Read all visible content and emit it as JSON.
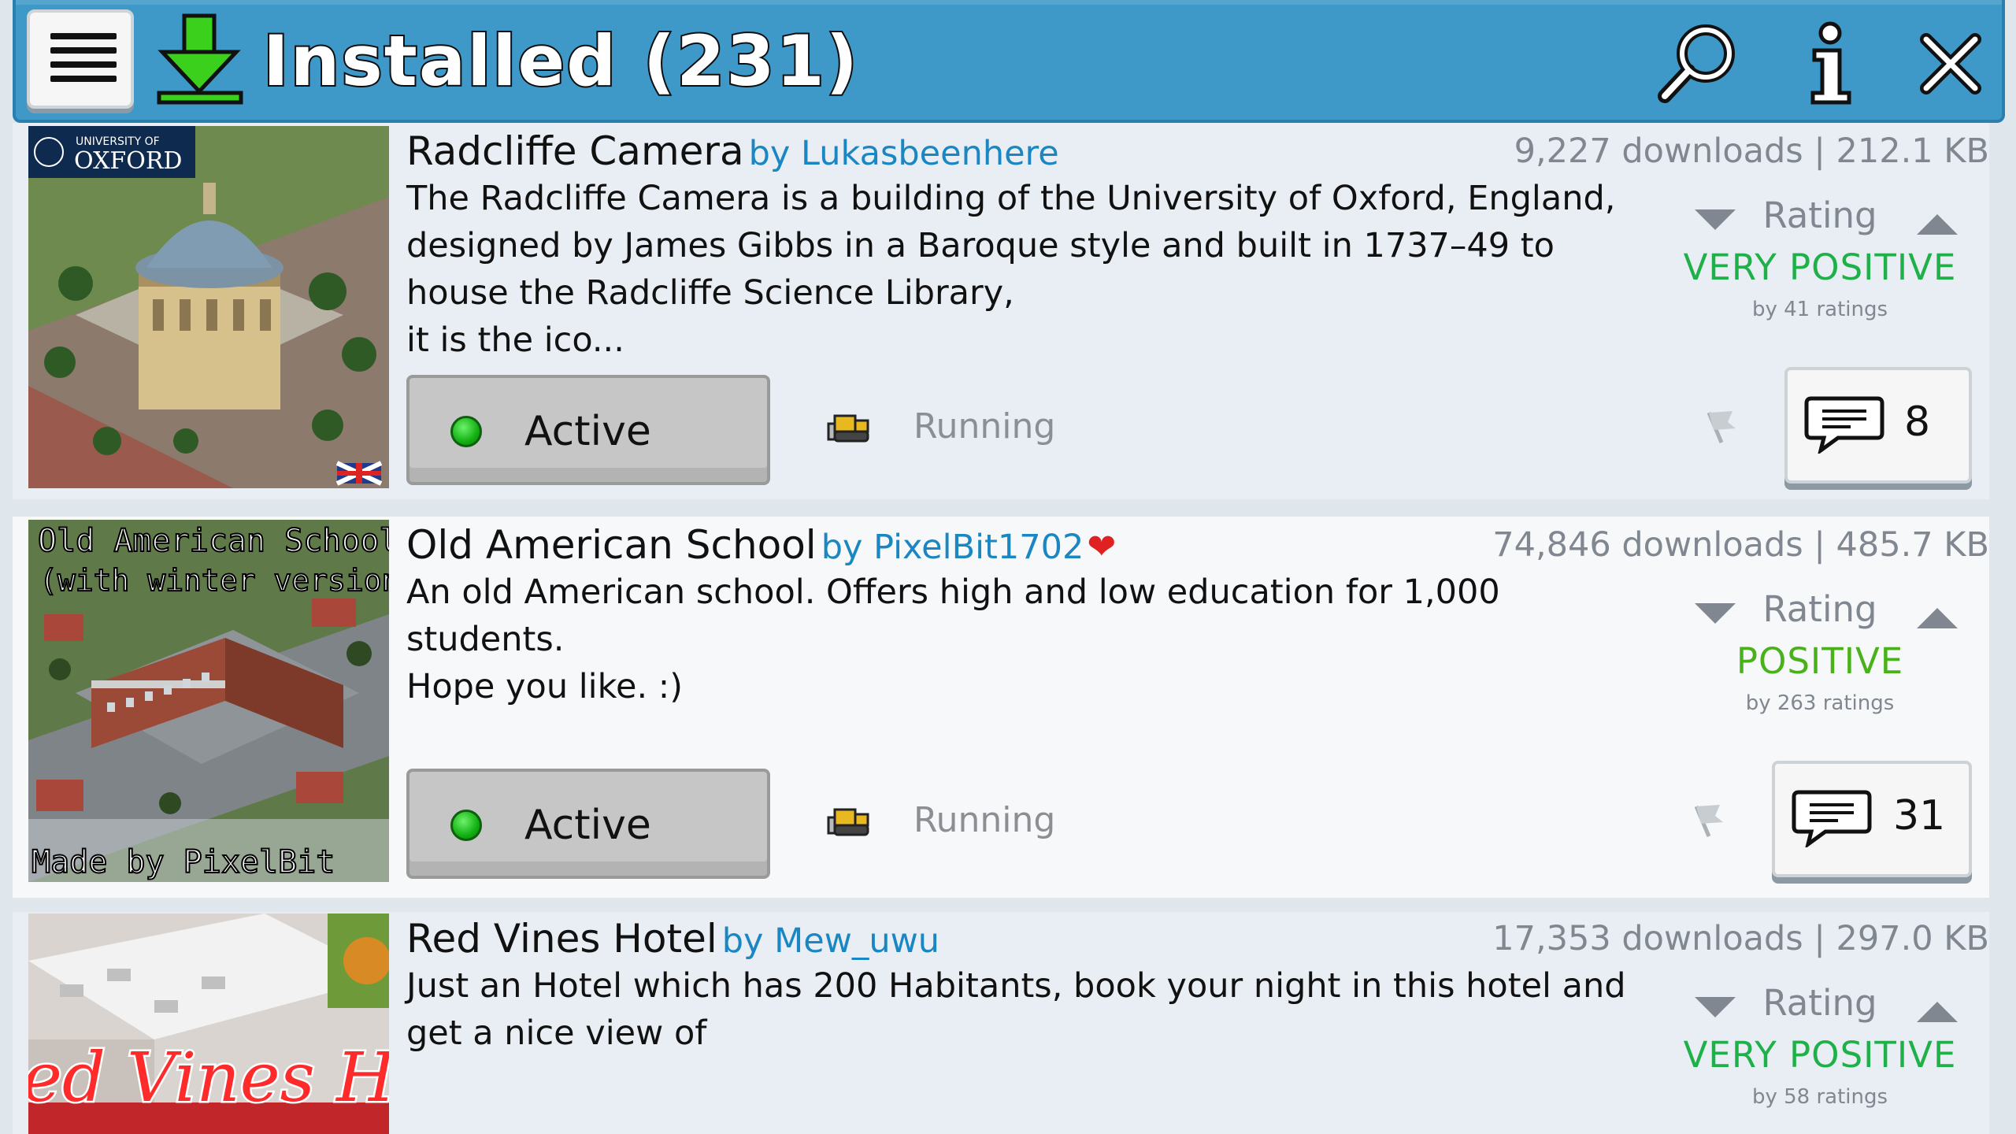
{
  "header": {
    "title": "Installed (231)",
    "icons": [
      "menu-icon",
      "download-icon",
      "search-icon",
      "info-icon",
      "close-icon"
    ]
  },
  "plugins": [
    {
      "name": "Radcliffe Camera",
      "author": "by Lukasbeenhere",
      "meta": "9,227 downloads | 212.1 KB",
      "description": "The Radcliffe Camera is a building of the University of Oxford, England, designed by James Gibbs in a Baroque style and built in 1737–49 to house the Radcliffe Science Library,\nit is the ico...",
      "thumb_text": [
        "UNIVERSITY OF",
        "OXFORD"
      ],
      "rating_label": "Rating",
      "rating_value": "VERY POSITIVE",
      "rating_count": "by 41 ratings",
      "status_button": "Active",
      "run_status": "Running",
      "comments": "8"
    },
    {
      "name": "Old American School",
      "author": "by PixelBit1702",
      "heart": "❤",
      "meta": "74,846 downloads | 485.7 KB",
      "description": "An old American school. Offers high and low education for 1,000 students.\nHope you like. :)",
      "thumb_text": [
        "Old American School",
        "(with winter version)",
        "Made by PixelBit"
      ],
      "rating_label": "Rating",
      "rating_value": "POSITIVE",
      "rating_count": "by 263 ratings",
      "status_button": "Active",
      "run_status": "Running",
      "comments": "31"
    },
    {
      "name": "Red Vines Hotel",
      "author": "by Mew_uwu",
      "meta": "17,353 downloads | 297.0 KB",
      "description": "Just an Hotel which has 200 Habitants, book your night in this hotel and get a nice view of",
      "thumb_text": [
        "ed Vines Hote"
      ],
      "rating_label": "Rating",
      "rating_value": "VERY POSITIVE",
      "rating_count": "by 58 ratings"
    }
  ],
  "colors": {
    "header_bg": "#3e99c9",
    "author_link": "#1a86c2",
    "very_positive": "#20b04a",
    "positive": "#49b21a",
    "muted": "#808790"
  }
}
